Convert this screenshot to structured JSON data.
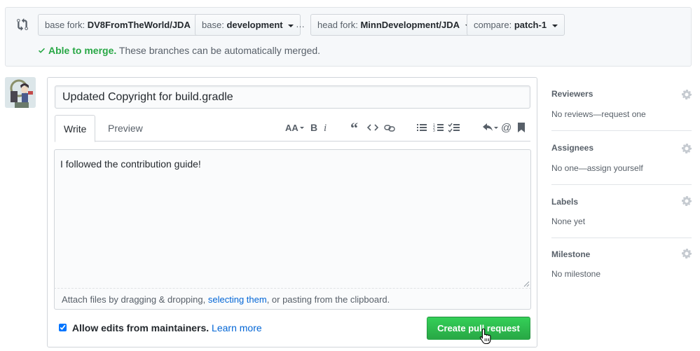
{
  "compare_bar": {
    "base_fork": {
      "label": "base fork:",
      "value": "DV8FromTheWorld/JDA"
    },
    "base": {
      "label": "base:",
      "value": "development"
    },
    "ellipsis": "…",
    "head_fork": {
      "label": "head fork:",
      "value": "MinnDevelopment/JDA"
    },
    "compare": {
      "label": "compare:",
      "value": "patch-1"
    },
    "merge_ok": "Able to merge.",
    "merge_text": "These branches can be automatically merged."
  },
  "form": {
    "title_value": "Updated Copyright for build.gradle",
    "tabs": [
      {
        "label": "Write"
      },
      {
        "label": "Preview"
      }
    ],
    "body_value": "I followed the contribution guide!",
    "drag_text_1": "Attach files by dragging & dropping, ",
    "drag_link": "selecting them",
    "drag_text_2": ", or pasting from the clipboard.",
    "allow_edits_label": "Allow edits from maintainers.",
    "learn_more": "Learn more",
    "create_button": "Create pull request"
  },
  "toolbar": {
    "icons": [
      "text-size-icon",
      "bold-icon",
      "italic-icon",
      "quote-icon",
      "code-icon",
      "link-icon",
      "unordered-list-icon",
      "ordered-list-icon",
      "task-list-icon",
      "reply-icon",
      "mention-icon",
      "bookmark-icon"
    ]
  },
  "sidebar": {
    "reviewers": {
      "heading": "Reviewers",
      "value": "No reviews—request one"
    },
    "assignees": {
      "heading": "Assignees",
      "value": "No one—assign yourself"
    },
    "labels": {
      "heading": "Labels",
      "value": "None yet"
    },
    "milestone": {
      "heading": "Milestone",
      "value": "No milestone"
    }
  },
  "colors": {
    "primary_green": "#28a745",
    "link_blue": "#0366d6",
    "muted_text": "#586069"
  }
}
